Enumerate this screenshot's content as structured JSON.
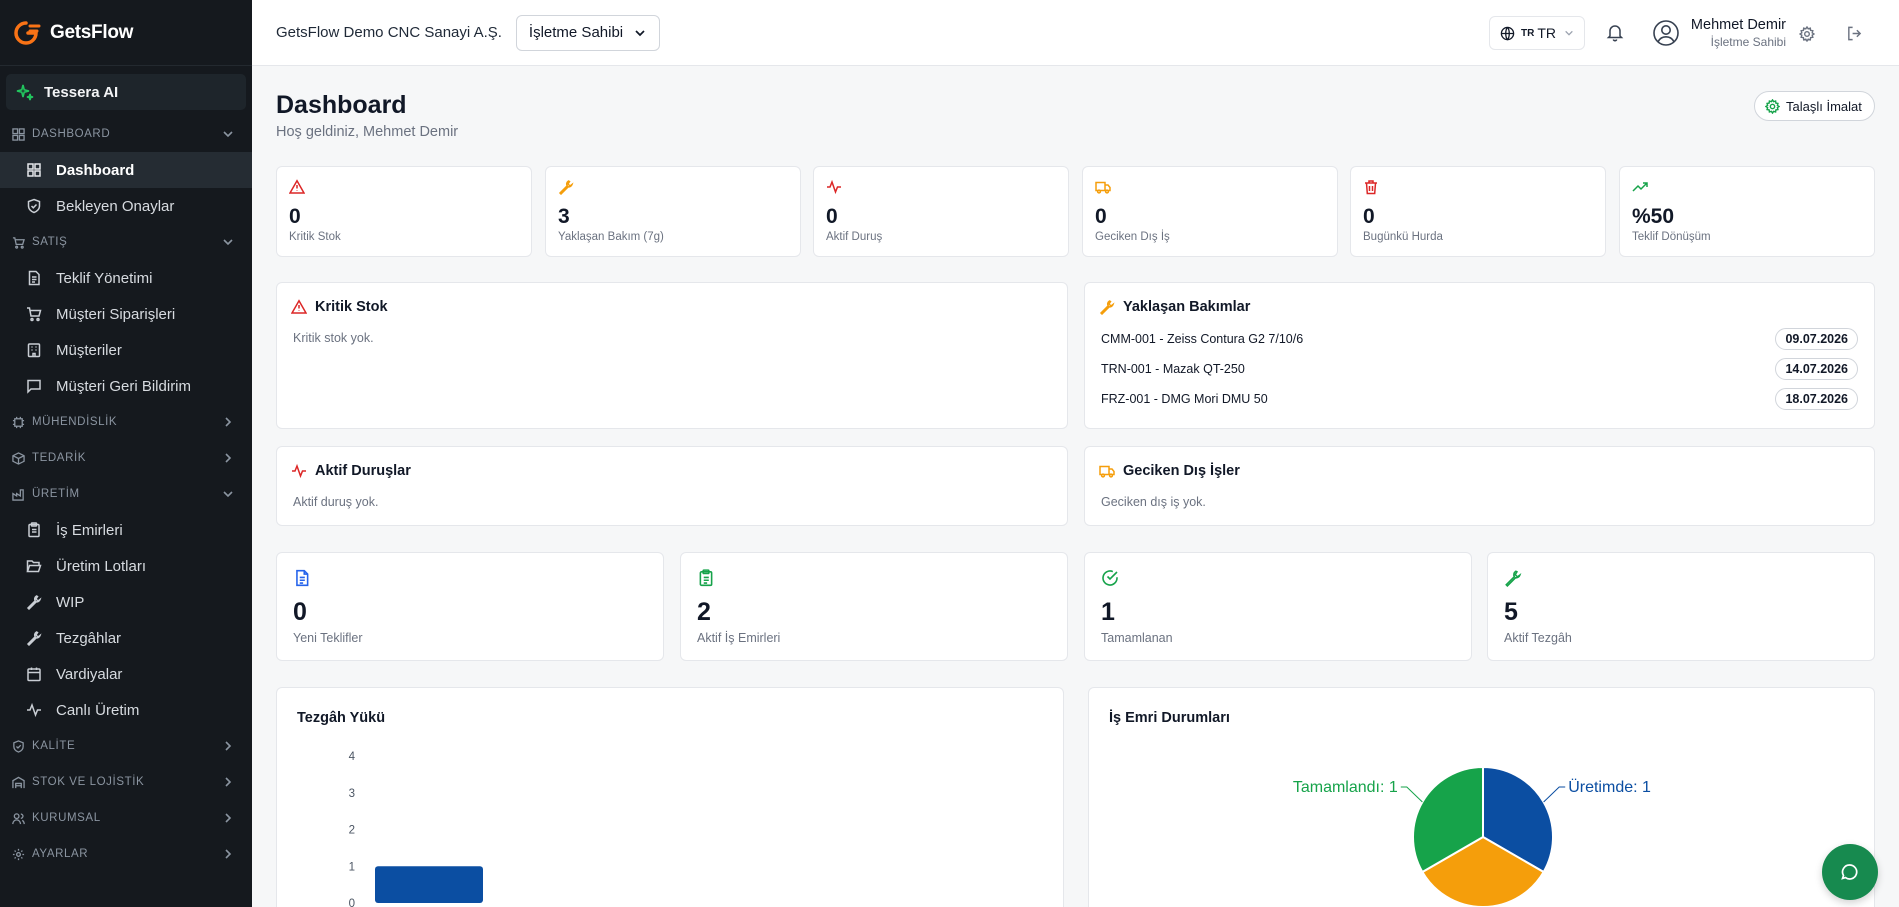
{
  "brand": {
    "name": "GetsFlow"
  },
  "sidebar": {
    "ai_label": "Tessera AI",
    "groups": [
      {
        "label": "DASHBOARD",
        "expanded": true,
        "items": [
          "Dashboard",
          "Bekleyen Onaylar"
        ]
      },
      {
        "label": "SATIŞ",
        "expanded": true,
        "items": [
          "Teklif Yönetimi",
          "Müşteri Siparişleri",
          "Müşteriler",
          "Müşteri Geri Bildirim"
        ]
      },
      {
        "label": "MÜHENDİSLİK",
        "expanded": false
      },
      {
        "label": "TEDARİK",
        "expanded": false
      },
      {
        "label": "ÜRETİM",
        "expanded": true,
        "items": [
          "İş Emirleri",
          "Üretim Lotları",
          "WIP",
          "Tezgâhlar",
          "Vardiyalar",
          "Canlı Üretim"
        ]
      },
      {
        "label": "KALİTE",
        "expanded": false
      },
      {
        "label": "STOK VE LOJİSTİK",
        "expanded": false
      },
      {
        "label": "KURUMSAL",
        "expanded": false
      },
      {
        "label": "AYARLAR",
        "expanded": false
      }
    ],
    "active_item": "Dashboard"
  },
  "topbar": {
    "company": "GetsFlow Demo CNC Sanayi A.Ş.",
    "role_select": "İşletme Sahibi",
    "lang_small": "TR",
    "lang": "TR",
    "user_name": "Mehmet Demir",
    "user_role": "İşletme Sahibi"
  },
  "page": {
    "title": "Dashboard",
    "subtitle": "Hoş geldiniz, Mehmet Demir",
    "mode_button": "Talaşlı İmalat"
  },
  "stats": [
    {
      "value": "0",
      "label": "Kritik Stok",
      "icon": "alert-triangle-icon",
      "color": "#dc2626"
    },
    {
      "value": "3",
      "label": "Yaklaşan Bakım (7g)",
      "icon": "wrench-icon",
      "color": "#f59e0b"
    },
    {
      "value": "0",
      "label": "Aktif Duruş",
      "icon": "activity-icon",
      "color": "#dc2626"
    },
    {
      "value": "0",
      "label": "Geciken Dış İş",
      "icon": "truck-icon",
      "color": "#f59e0b"
    },
    {
      "value": "0",
      "label": "Bugünkü Hurda",
      "icon": "trash-icon",
      "color": "#dc2626"
    },
    {
      "value": "%50",
      "label": "Teklif Dönüşüm",
      "icon": "trending-up-icon",
      "color": "#16a34a"
    }
  ],
  "panels": {
    "kritik_stok": {
      "title": "Kritik Stok",
      "empty": "Kritik stok yok."
    },
    "bakimlar": {
      "title": "Yaklaşan Bakımlar",
      "rows": [
        {
          "machine": "CMM-001 - Zeiss Contura G2 7/10/6",
          "date": "09.07.2026"
        },
        {
          "machine": "TRN-001 - Mazak QT-250",
          "date": "14.07.2026"
        },
        {
          "machine": "FRZ-001 - DMG Mori DMU 50",
          "date": "18.07.2026"
        }
      ]
    },
    "durus": {
      "title": "Aktif Duruşlar",
      "empty": "Aktif duruş yok."
    },
    "dis_is": {
      "title": "Geciken Dış İşler",
      "empty": "Geciken dış iş yok."
    }
  },
  "big_stats": [
    {
      "value": "0",
      "label": "Yeni Teklifler",
      "icon": "file-text-icon",
      "color": "#2563eb"
    },
    {
      "value": "2",
      "label": "Aktif İş Emirleri",
      "icon": "clipboard-list-icon",
      "color": "#16a34a"
    },
    {
      "value": "1",
      "label": "Tamamlanan",
      "icon": "check-circle-icon",
      "color": "#16a34a"
    },
    {
      "value": "5",
      "label": "Aktif Tezgâh",
      "icon": "wrench-icon",
      "color": "#16a34a"
    }
  ],
  "chart_data": [
    {
      "type": "bar",
      "title": "Tezgâh Yükü",
      "y_ticks": [
        "0",
        "1",
        "2",
        "3",
        "4"
      ],
      "ylim": [
        0,
        4
      ],
      "values": [
        1
      ],
      "color": "#0b4ea2"
    },
    {
      "type": "pie",
      "title": "İş Emri Durumları",
      "slices": [
        {
          "label": "Üretimde: 1",
          "value": 1,
          "color": "#0b4ea2"
        },
        {
          "label": "",
          "value": 1,
          "color": "#f59e0b"
        },
        {
          "label": "Tamamlandı: 1",
          "value": 1,
          "color": "#16a34a"
        }
      ]
    }
  ]
}
